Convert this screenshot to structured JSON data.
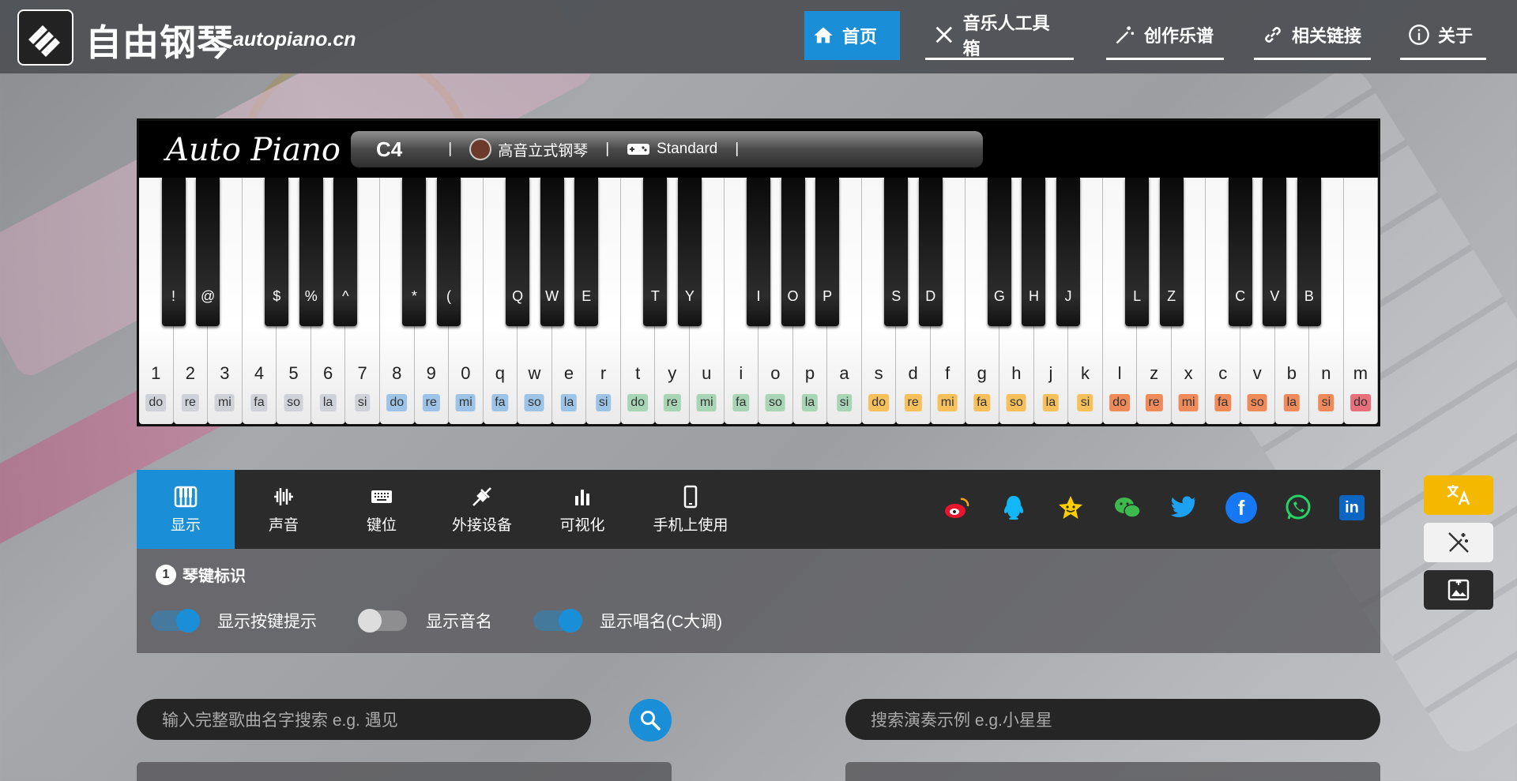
{
  "header": {
    "site_title": "自由钢琴",
    "site_domain": "autopiano.cn",
    "nav": [
      {
        "label": "首页",
        "icon": "home-icon",
        "active": true
      },
      {
        "label": "音乐人工具箱",
        "icon": "tools-icon",
        "active": false
      },
      {
        "label": "创作乐谱",
        "icon": "magic-wand-icon",
        "active": false
      },
      {
        "label": "相关链接",
        "icon": "link-icon",
        "active": false
      },
      {
        "label": "关于",
        "icon": "info-icon",
        "active": false
      }
    ]
  },
  "piano": {
    "brand": "Auto Piano",
    "current_note": "C4",
    "instrument": "高音立式钢琴",
    "layout": "Standard",
    "separator": "|",
    "white_keys": [
      {
        "key": "1",
        "solfege": "do",
        "color": "#cfd2d8"
      },
      {
        "key": "2",
        "solfege": "re",
        "color": "#cfd2d8"
      },
      {
        "key": "3",
        "solfege": "mi",
        "color": "#cfd2d8"
      },
      {
        "key": "4",
        "solfege": "fa",
        "color": "#cfd2d8"
      },
      {
        "key": "5",
        "solfege": "so",
        "color": "#cfd2d8"
      },
      {
        "key": "6",
        "solfege": "la",
        "color": "#cfd2d8"
      },
      {
        "key": "7",
        "solfege": "si",
        "color": "#cfd2d8"
      },
      {
        "key": "8",
        "solfege": "do",
        "color": "#9dc3e6"
      },
      {
        "key": "9",
        "solfege": "re",
        "color": "#9dc3e6"
      },
      {
        "key": "0",
        "solfege": "mi",
        "color": "#9dc3e6"
      },
      {
        "key": "q",
        "solfege": "fa",
        "color": "#9dc3e6"
      },
      {
        "key": "w",
        "solfege": "so",
        "color": "#9dc3e6"
      },
      {
        "key": "e",
        "solfege": "la",
        "color": "#9dc3e6"
      },
      {
        "key": "r",
        "solfege": "si",
        "color": "#9dc3e6"
      },
      {
        "key": "t",
        "solfege": "do",
        "color": "#a8d5b5"
      },
      {
        "key": "y",
        "solfege": "re",
        "color": "#a8d5b5"
      },
      {
        "key": "u",
        "solfege": "mi",
        "color": "#a8d5b5"
      },
      {
        "key": "i",
        "solfege": "fa",
        "color": "#a8d5b5"
      },
      {
        "key": "o",
        "solfege": "so",
        "color": "#a8d5b5"
      },
      {
        "key": "p",
        "solfege": "la",
        "color": "#a8d5b5"
      },
      {
        "key": "a",
        "solfege": "si",
        "color": "#a8d5b5"
      },
      {
        "key": "s",
        "solfege": "do",
        "color": "#f6c05a"
      },
      {
        "key": "d",
        "solfege": "re",
        "color": "#f6c05a"
      },
      {
        "key": "f",
        "solfege": "mi",
        "color": "#f6c05a"
      },
      {
        "key": "g",
        "solfege": "fa",
        "color": "#f6c05a"
      },
      {
        "key": "h",
        "solfege": "so",
        "color": "#f6c05a"
      },
      {
        "key": "j",
        "solfege": "la",
        "color": "#f6c05a"
      },
      {
        "key": "k",
        "solfege": "si",
        "color": "#f6c05a"
      },
      {
        "key": "l",
        "solfege": "do",
        "color": "#ef8a5a"
      },
      {
        "key": "z",
        "solfege": "re",
        "color": "#ef8a5a"
      },
      {
        "key": "x",
        "solfege": "mi",
        "color": "#ef8a5a"
      },
      {
        "key": "c",
        "solfege": "fa",
        "color": "#ef8a5a"
      },
      {
        "key": "v",
        "solfege": "so",
        "color": "#ef8a5a"
      },
      {
        "key": "b",
        "solfege": "la",
        "color": "#ef8a5a"
      },
      {
        "key": "n",
        "solfege": "si",
        "color": "#ef8a5a"
      },
      {
        "key": "m",
        "solfege": "do",
        "color": "#e8707a"
      }
    ],
    "black_keys": [
      {
        "key": "!",
        "after_white": 0
      },
      {
        "key": "@",
        "after_white": 1
      },
      {
        "key": "$",
        "after_white": 3
      },
      {
        "key": "%",
        "after_white": 4
      },
      {
        "key": "^",
        "after_white": 5
      },
      {
        "key": "*",
        "after_white": 7
      },
      {
        "key": "(",
        "after_white": 8
      },
      {
        "key": "Q",
        "after_white": 10
      },
      {
        "key": "W",
        "after_white": 11
      },
      {
        "key": "E",
        "after_white": 12
      },
      {
        "key": "T",
        "after_white": 14
      },
      {
        "key": "Y",
        "after_white": 15
      },
      {
        "key": "I",
        "after_white": 17
      },
      {
        "key": "O",
        "after_white": 18
      },
      {
        "key": "P",
        "after_white": 19
      },
      {
        "key": "S",
        "after_white": 21
      },
      {
        "key": "D",
        "after_white": 22
      },
      {
        "key": "G",
        "after_white": 24
      },
      {
        "key": "H",
        "after_white": 25
      },
      {
        "key": "J",
        "after_white": 26
      },
      {
        "key": "L",
        "after_white": 28
      },
      {
        "key": "Z",
        "after_white": 29
      },
      {
        "key": "C",
        "after_white": 31
      },
      {
        "key": "V",
        "after_white": 32
      },
      {
        "key": "B",
        "after_white": 33
      }
    ]
  },
  "panel": {
    "tabs": [
      {
        "label": "显示",
        "icon": "piano-icon",
        "active": true
      },
      {
        "label": "声音",
        "icon": "waveform-icon",
        "active": false
      },
      {
        "label": "键位",
        "icon": "keyboard-icon",
        "active": false
      },
      {
        "label": "外接设备",
        "icon": "plug-icon",
        "active": false
      },
      {
        "label": "可视化",
        "icon": "bar-chart-icon",
        "active": false
      },
      {
        "label": "手机上使用",
        "icon": "phone-icon",
        "active": false
      }
    ],
    "socials": [
      {
        "name": "weibo-icon",
        "color": "#e6162d"
      },
      {
        "name": "qq-icon",
        "color": "#12b7f5"
      },
      {
        "name": "qzone-icon",
        "color": "#fece00"
      },
      {
        "name": "wechat-icon",
        "color": "#3eb94e"
      },
      {
        "name": "twitter-icon",
        "color": "#1da1f2"
      },
      {
        "name": "facebook-icon",
        "color": "#1877f2"
      },
      {
        "name": "whatsapp-icon",
        "color": "#25d366"
      },
      {
        "name": "linkedin-icon",
        "color": "#0a66c2"
      }
    ],
    "section_number": "1",
    "section_title": "琴键标识",
    "options": [
      {
        "label": "显示按键提示",
        "on": true
      },
      {
        "label": "显示音名",
        "on": false
      },
      {
        "label": "显示唱名(C大调)",
        "on": true
      }
    ]
  },
  "search": {
    "song_placeholder": "输入完整歌曲名字搜索  e.g. 遇见",
    "demo_placeholder": "搜索演奏示例  e.g.小星星"
  },
  "colors": {
    "accent": "#1a8fd8",
    "translate_button": "#f5b800"
  }
}
